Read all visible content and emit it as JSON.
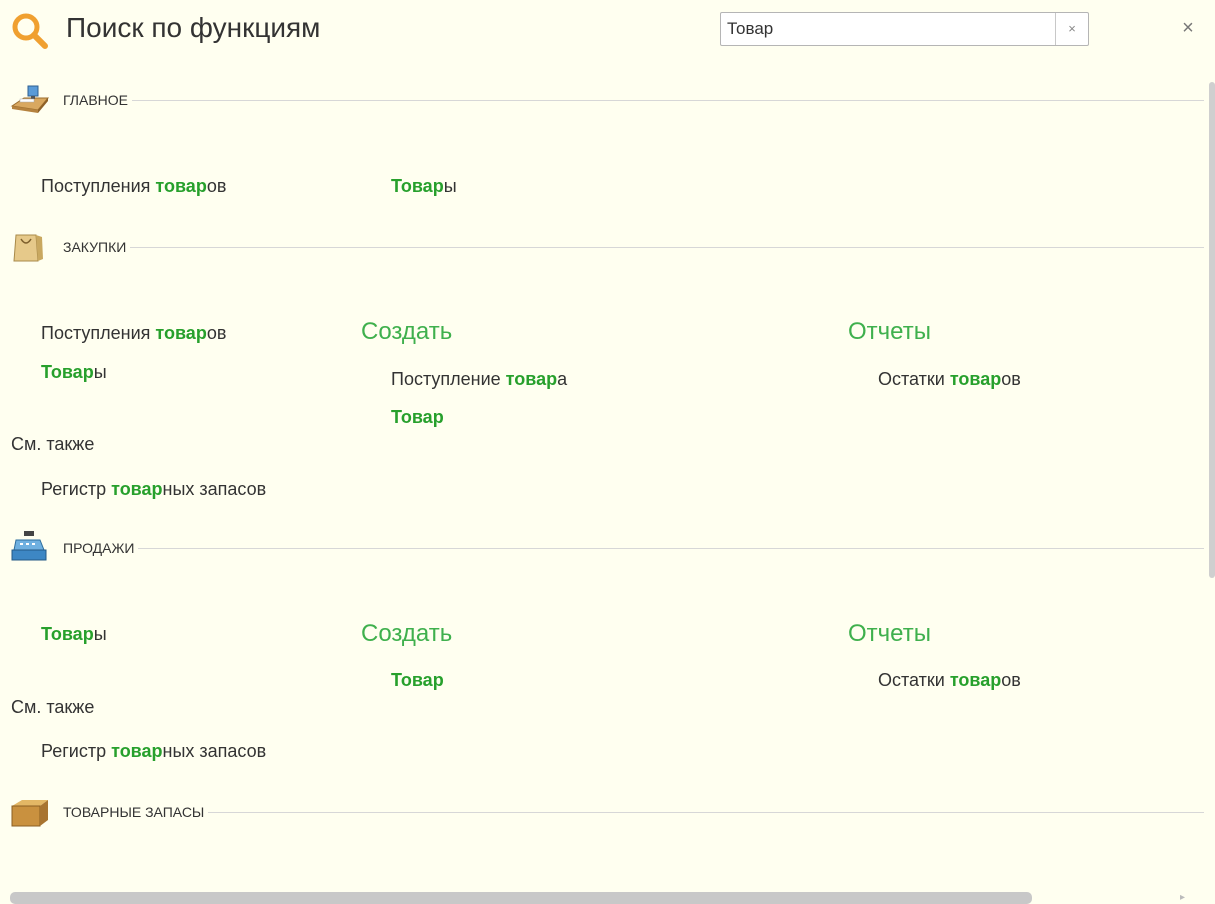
{
  "header": {
    "title": "Поиск по функциям",
    "search_value": "Товар",
    "clear_label": "×",
    "close_label": "×"
  },
  "see_also_label": "См. также",
  "sections": [
    {
      "title": "ГЛАВНОЕ",
      "icon": "desk-icon",
      "items": [
        {
          "pre": "Поступления ",
          "hl": "товар",
          "post": "ов"
        },
        {
          "pre": "",
          "hl": "Товар",
          "post": "ы"
        }
      ]
    },
    {
      "title": "ЗАКУПКИ",
      "icon": "shopping-bag-icon",
      "items": [
        {
          "pre": "Поступления ",
          "hl": "товар",
          "post": "ов"
        },
        {
          "pre": "",
          "hl": "Товар",
          "post": "ы"
        }
      ],
      "create_title": "Создать",
      "create_items": [
        {
          "pre": "Поступление ",
          "hl": "товар",
          "post": "а"
        },
        {
          "pre": "",
          "hl": "Товар",
          "post": ""
        }
      ],
      "reports_title": "Отчеты",
      "reports_items": [
        {
          "pre": "Остатки ",
          "hl": "товар",
          "post": "ов"
        }
      ],
      "see_also_items": [
        {
          "pre": "Регистр ",
          "hl": "товар",
          "post": "ных запасов"
        }
      ]
    },
    {
      "title": "ПРОДАЖИ",
      "icon": "cash-register-icon",
      "items": [
        {
          "pre": "",
          "hl": "Товар",
          "post": "ы"
        }
      ],
      "create_title": "Создать",
      "create_items": [
        {
          "pre": "",
          "hl": "Товар",
          "post": ""
        }
      ],
      "reports_title": "Отчеты",
      "reports_items": [
        {
          "pre": "Остатки ",
          "hl": "товар",
          "post": "ов"
        }
      ],
      "see_also_items": [
        {
          "pre": "Регистр ",
          "hl": "товар",
          "post": "ных запасов"
        }
      ]
    },
    {
      "title": "ТОВАРНЫЕ ЗАПАСЫ",
      "icon": "cardboard-box-icon",
      "items": []
    }
  ],
  "colors": {
    "background": "#fffff0",
    "highlight": "#27a02c",
    "group_title": "#3fb04d",
    "search_icon": "#f0a030"
  }
}
